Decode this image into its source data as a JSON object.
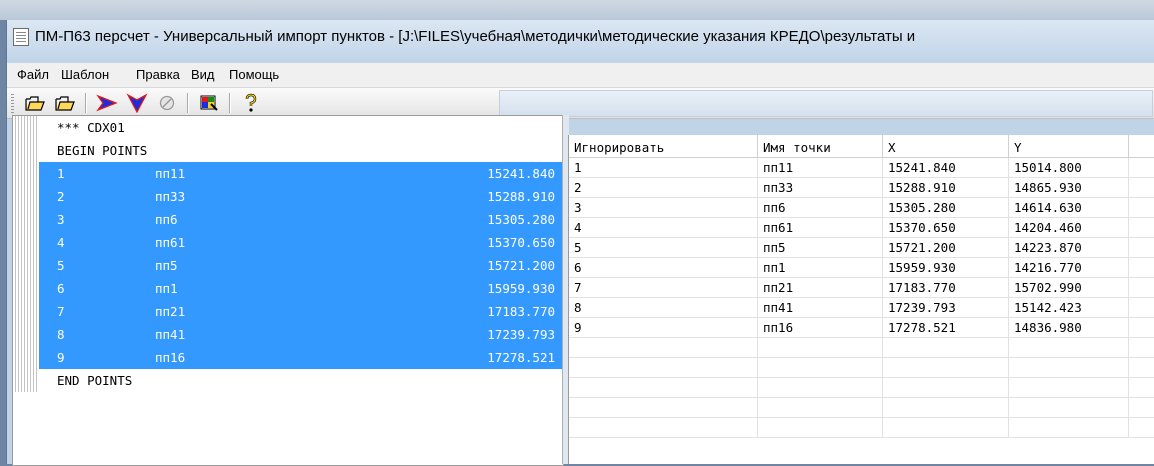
{
  "title": "ПМ-П63 перcчет - Универсальный импорт пунктов - [J:\\FILES\\учебная\\методички\\методические указания КРЕДО\\результаты и",
  "menu": [
    "Файл",
    "Шаблон",
    "Правка",
    "Вид",
    "Помощь"
  ],
  "toolbar": {
    "icons": [
      "open-folder-icon",
      "open-folder-icon",
      "arrow-right-icon",
      "arrow-down-icon",
      "cancel-icon",
      "color-palette-icon",
      "help-icon"
    ]
  },
  "source": {
    "header_line": "*** CDX01",
    "begin_line": "BEGIN POINTS",
    "end_line": "END POINTS",
    "rows": [
      {
        "num": "1",
        "name": "пп11",
        "x": "15241.840"
      },
      {
        "num": "2",
        "name": "пп33",
        "x": "15288.910"
      },
      {
        "num": "3",
        "name": "пп6",
        "x": "15305.280"
      },
      {
        "num": "4",
        "name": "пп61",
        "x": "15370.650"
      },
      {
        "num": "5",
        "name": "пп5",
        "x": "15721.200"
      },
      {
        "num": "6",
        "name": "пп1",
        "x": "15959.930"
      },
      {
        "num": "7",
        "name": "пп21",
        "x": "17183.770"
      },
      {
        "num": "8",
        "name": "пп41",
        "x": "17239.793"
      },
      {
        "num": "9",
        "name": "пп16",
        "x": "17278.521"
      }
    ]
  },
  "grid": {
    "columns": [
      "Игнорировать",
      "Имя точки",
      "X",
      "Y"
    ],
    "rows": [
      [
        "1",
        "пп11",
        "15241.840",
        "15014.800"
      ],
      [
        "2",
        "пп33",
        "15288.910",
        "14865.930"
      ],
      [
        "3",
        "пп6",
        "15305.280",
        "14614.630"
      ],
      [
        "4",
        "пп61",
        "15370.650",
        "14204.460"
      ],
      [
        "5",
        "пп5",
        "15721.200",
        "14223.870"
      ],
      [
        "6",
        "пп1",
        "15959.930",
        "14216.770"
      ],
      [
        "7",
        "пп21",
        "17183.770",
        "15702.990"
      ],
      [
        "8",
        "пп41",
        "17239.793",
        "15142.423"
      ],
      [
        "9",
        "пп16",
        "17278.521",
        "14836.980"
      ]
    ]
  },
  "colors": {
    "selection": "#3399ff",
    "title_bg": "#c1d4e8"
  }
}
